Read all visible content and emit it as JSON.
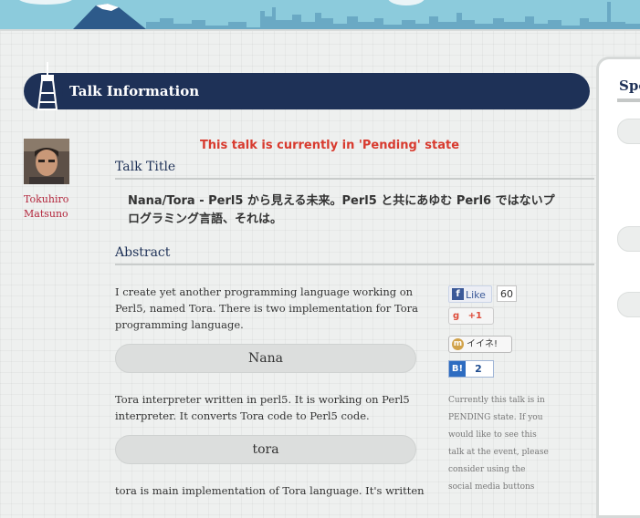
{
  "page": {
    "title": "Talk Information",
    "sidebar_heading": "Spo"
  },
  "speaker": {
    "first_name": "Tokuhiro",
    "last_name": "Matsuno"
  },
  "status_message": "This talk is currently in 'Pending' state",
  "talk": {
    "title_heading": "Talk Title",
    "title": "Nana/Tora - Perl5 から見える未来。Perl5 と共にあゆむ Perl6 ではないプログラミング言語、それは。",
    "abstract_heading": "Abstract",
    "abstract_intro": "I create yet another programming language working on Perl5, named Tora. There is two implementation for Tora programming language.",
    "sections": [
      {
        "button_label": "Nana",
        "text": "Tora interpreter written in perl5. It is working on Perl5 interpreter. It converts Tora code to Perl5 code."
      },
      {
        "button_label": "tora",
        "text": "tora is main implementation of Tora language. It's written"
      }
    ]
  },
  "social": {
    "facebook_label": "Like",
    "facebook_count": "60",
    "gplus_label": "+1",
    "mixi_label": "イイネ!",
    "hatena_label": "B!",
    "hatena_count": "2"
  },
  "pending_note": "Currently this talk is in PENDING state. If you would like to see this talk at the event, please consider using the social media buttons",
  "colors": {
    "navy": "#1e3157",
    "status_red": "#d83a2e",
    "speaker_red": "#b3263c",
    "sky": "#7fc3d6"
  }
}
